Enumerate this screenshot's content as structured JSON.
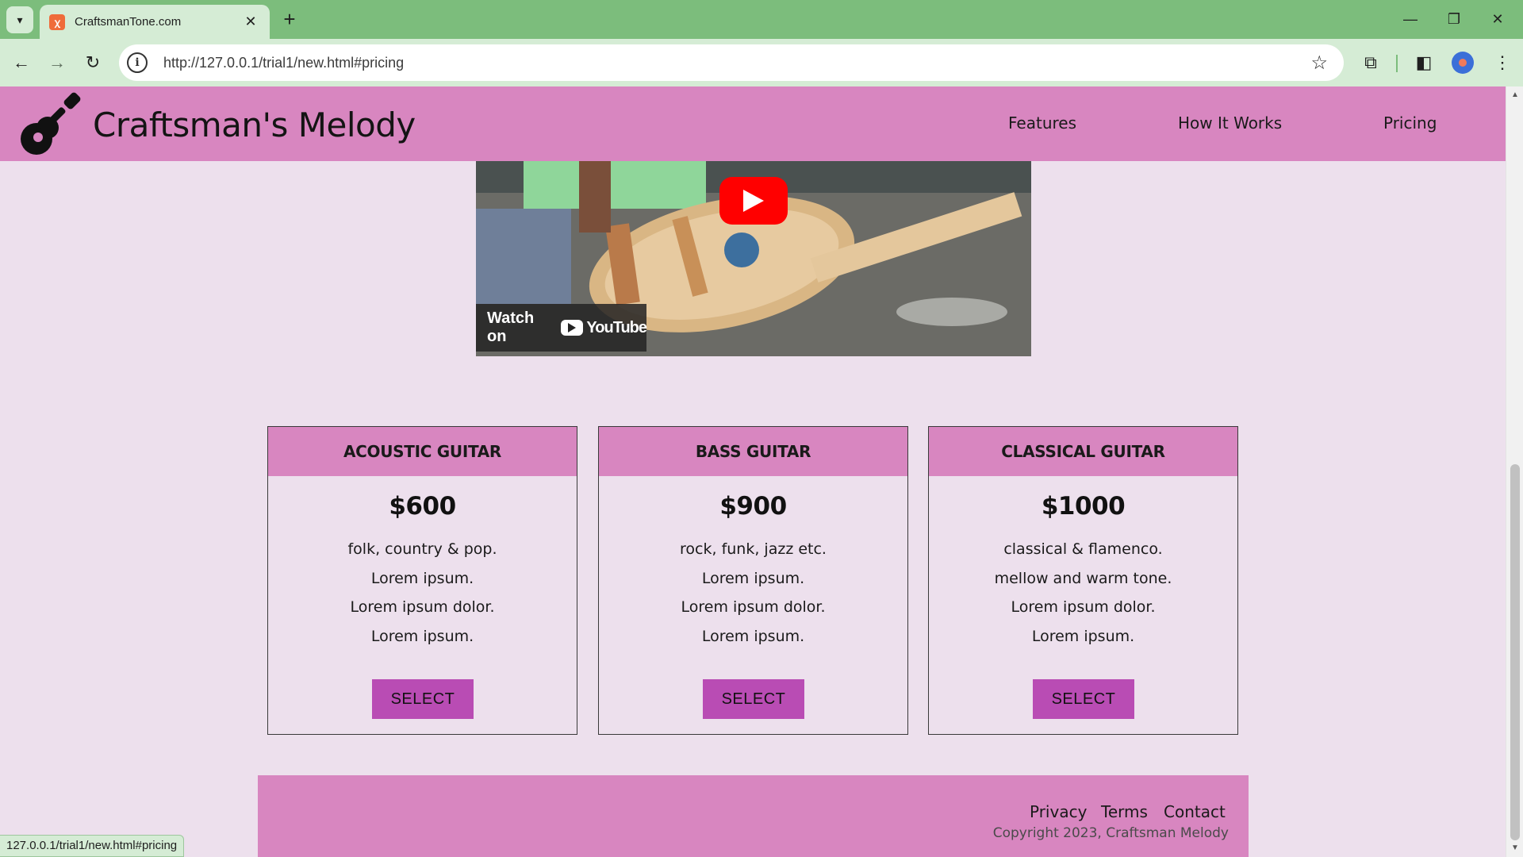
{
  "browser": {
    "tab_title": "CraftsmanTone.com",
    "tab_favicon": "xampp-icon",
    "url": "http://127.0.0.1/trial1/new.html#pricing",
    "status_url": "127.0.0.1/trial1/new.html#pricing"
  },
  "site": {
    "brand": "Craftsman's Melody",
    "nav": [
      "Features",
      "How It Works",
      "Pricing"
    ]
  },
  "video": {
    "watch_on": "Watch on",
    "youtube": "YouTube"
  },
  "pricing": [
    {
      "name": "ACOUSTIC GUITAR",
      "price": "$600",
      "features": [
        "folk, country & pop.",
        "Lorem ipsum.",
        "Lorem ipsum dolor.",
        "Lorem ipsum."
      ],
      "button": "SELECT"
    },
    {
      "name": "BASS GUITAR",
      "price": "$900",
      "features": [
        "rock, funk, jazz etc.",
        "Lorem ipsum.",
        "Lorem ipsum dolor.",
        "Lorem ipsum."
      ],
      "button": "SELECT"
    },
    {
      "name": "CLASSICAL GUITAR",
      "price": "$1000",
      "features": [
        "classical & flamenco.",
        "mellow and warm tone.",
        "Lorem ipsum dolor.",
        "Lorem ipsum."
      ],
      "button": "SELECT"
    }
  ],
  "footer": {
    "links": [
      "Privacy",
      "Terms",
      "Contact"
    ],
    "copyright": "Copyright 2023, Craftsman Melody"
  },
  "colors": {
    "browser_frame": "#7cbd7c",
    "browser_toolbar": "#d5ecd5",
    "page_bg": "#ede0ed",
    "header_bg": "#d886c0",
    "button_bg": "#b94cb4"
  }
}
